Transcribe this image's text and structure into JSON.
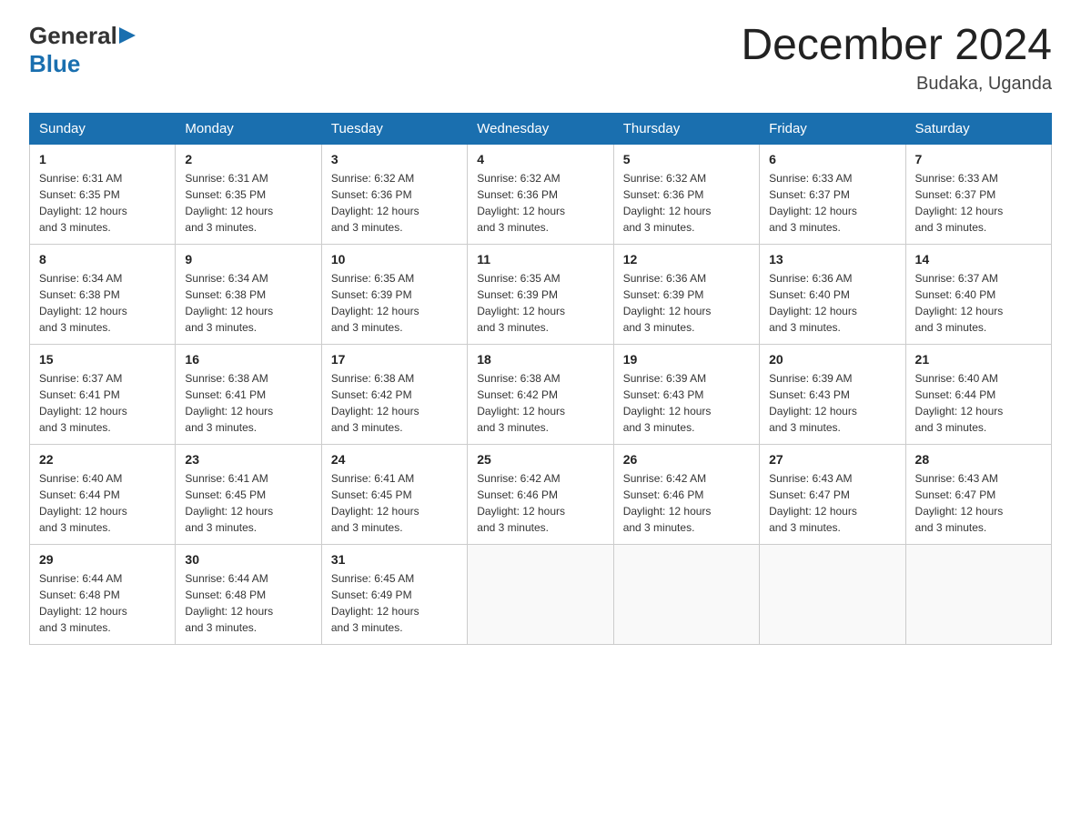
{
  "logo": {
    "text_general": "General",
    "text_blue": "Blue"
  },
  "title": "December 2024",
  "location": "Budaka, Uganda",
  "days_of_week": [
    "Sunday",
    "Monday",
    "Tuesday",
    "Wednesday",
    "Thursday",
    "Friday",
    "Saturday"
  ],
  "weeks": [
    [
      {
        "day": "1",
        "sunrise": "6:31 AM",
        "sunset": "6:35 PM",
        "daylight": "12 hours and 3 minutes."
      },
      {
        "day": "2",
        "sunrise": "6:31 AM",
        "sunset": "6:35 PM",
        "daylight": "12 hours and 3 minutes."
      },
      {
        "day": "3",
        "sunrise": "6:32 AM",
        "sunset": "6:36 PM",
        "daylight": "12 hours and 3 minutes."
      },
      {
        "day": "4",
        "sunrise": "6:32 AM",
        "sunset": "6:36 PM",
        "daylight": "12 hours and 3 minutes."
      },
      {
        "day": "5",
        "sunrise": "6:32 AM",
        "sunset": "6:36 PM",
        "daylight": "12 hours and 3 minutes."
      },
      {
        "day": "6",
        "sunrise": "6:33 AM",
        "sunset": "6:37 PM",
        "daylight": "12 hours and 3 minutes."
      },
      {
        "day": "7",
        "sunrise": "6:33 AM",
        "sunset": "6:37 PM",
        "daylight": "12 hours and 3 minutes."
      }
    ],
    [
      {
        "day": "8",
        "sunrise": "6:34 AM",
        "sunset": "6:38 PM",
        "daylight": "12 hours and 3 minutes."
      },
      {
        "day": "9",
        "sunrise": "6:34 AM",
        "sunset": "6:38 PM",
        "daylight": "12 hours and 3 minutes."
      },
      {
        "day": "10",
        "sunrise": "6:35 AM",
        "sunset": "6:39 PM",
        "daylight": "12 hours and 3 minutes."
      },
      {
        "day": "11",
        "sunrise": "6:35 AM",
        "sunset": "6:39 PM",
        "daylight": "12 hours and 3 minutes."
      },
      {
        "day": "12",
        "sunrise": "6:36 AM",
        "sunset": "6:39 PM",
        "daylight": "12 hours and 3 minutes."
      },
      {
        "day": "13",
        "sunrise": "6:36 AM",
        "sunset": "6:40 PM",
        "daylight": "12 hours and 3 minutes."
      },
      {
        "day": "14",
        "sunrise": "6:37 AM",
        "sunset": "6:40 PM",
        "daylight": "12 hours and 3 minutes."
      }
    ],
    [
      {
        "day": "15",
        "sunrise": "6:37 AM",
        "sunset": "6:41 PM",
        "daylight": "12 hours and 3 minutes."
      },
      {
        "day": "16",
        "sunrise": "6:38 AM",
        "sunset": "6:41 PM",
        "daylight": "12 hours and 3 minutes."
      },
      {
        "day": "17",
        "sunrise": "6:38 AM",
        "sunset": "6:42 PM",
        "daylight": "12 hours and 3 minutes."
      },
      {
        "day": "18",
        "sunrise": "6:38 AM",
        "sunset": "6:42 PM",
        "daylight": "12 hours and 3 minutes."
      },
      {
        "day": "19",
        "sunrise": "6:39 AM",
        "sunset": "6:43 PM",
        "daylight": "12 hours and 3 minutes."
      },
      {
        "day": "20",
        "sunrise": "6:39 AM",
        "sunset": "6:43 PM",
        "daylight": "12 hours and 3 minutes."
      },
      {
        "day": "21",
        "sunrise": "6:40 AM",
        "sunset": "6:44 PM",
        "daylight": "12 hours and 3 minutes."
      }
    ],
    [
      {
        "day": "22",
        "sunrise": "6:40 AM",
        "sunset": "6:44 PM",
        "daylight": "12 hours and 3 minutes."
      },
      {
        "day": "23",
        "sunrise": "6:41 AM",
        "sunset": "6:45 PM",
        "daylight": "12 hours and 3 minutes."
      },
      {
        "day": "24",
        "sunrise": "6:41 AM",
        "sunset": "6:45 PM",
        "daylight": "12 hours and 3 minutes."
      },
      {
        "day": "25",
        "sunrise": "6:42 AM",
        "sunset": "6:46 PM",
        "daylight": "12 hours and 3 minutes."
      },
      {
        "day": "26",
        "sunrise": "6:42 AM",
        "sunset": "6:46 PM",
        "daylight": "12 hours and 3 minutes."
      },
      {
        "day": "27",
        "sunrise": "6:43 AM",
        "sunset": "6:47 PM",
        "daylight": "12 hours and 3 minutes."
      },
      {
        "day": "28",
        "sunrise": "6:43 AM",
        "sunset": "6:47 PM",
        "daylight": "12 hours and 3 minutes."
      }
    ],
    [
      {
        "day": "29",
        "sunrise": "6:44 AM",
        "sunset": "6:48 PM",
        "daylight": "12 hours and 3 minutes."
      },
      {
        "day": "30",
        "sunrise": "6:44 AM",
        "sunset": "6:48 PM",
        "daylight": "12 hours and 3 minutes."
      },
      {
        "day": "31",
        "sunrise": "6:45 AM",
        "sunset": "6:49 PM",
        "daylight": "12 hours and 3 minutes."
      },
      null,
      null,
      null,
      null
    ]
  ]
}
